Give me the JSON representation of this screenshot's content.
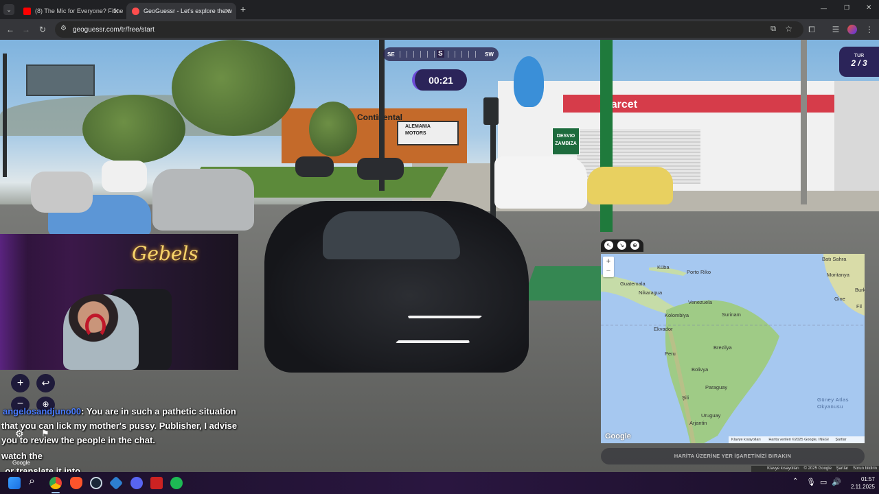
{
  "browser": {
    "tabs": [
      {
        "title": "(8) The Mic for Everyone? Fifine",
        "active": false
      },
      {
        "title": "GeoGuessr - Let's explore the w",
        "active": true
      }
    ],
    "new_tab": "+",
    "url": "geoguessr.com/tr/free/start",
    "window_controls": {
      "minimize": "—",
      "restore": "❐",
      "close": "✕"
    }
  },
  "hud": {
    "compass": {
      "left": "SE",
      "center": "S",
      "right": "SW"
    },
    "timer": "00:21",
    "round": {
      "label": "TUR",
      "value": "2 / 3"
    }
  },
  "scene_signs": {
    "store1": "ALEMANIA",
    "store1b": "MOTORS",
    "store2": "Continental",
    "store3": "parcet",
    "street": "DESVIO ZAMBIZA"
  },
  "webcam": {
    "neon": "Gebels"
  },
  "map_controls": {
    "zoom_in": "+",
    "zoom_out": "−",
    "undo": "↩"
  },
  "map": {
    "zoom_in": "+",
    "zoom_out": "−",
    "labels": [
      "Küba",
      "Porto Riko",
      "Guatemala",
      "Nikaragua",
      "Venezuela",
      "Surinam",
      "Kolombiya",
      "Ekvador",
      "Peru",
      "Brezilya",
      "Bolivya",
      "Paraguay",
      "Şili",
      "Uruguay",
      "Arjantin",
      "Güney Atlas Okyanusu",
      "Batı Sahra",
      "Moritanya",
      "Gine",
      "Burk",
      "Fil"
    ],
    "logo": "Google",
    "footer_shortcuts": "Klavye kısayolları",
    "footer_data": "Harita verileri ©2025 Google, INEGI",
    "footer_terms": "Şartlar",
    "place_button": "HARİTA ÜZERİNE YER İŞARETİNİZİ BIRAKIN"
  },
  "chat": {
    "user": "angelosandjuno00",
    "lines": [
      ": You are in such a pathetic situation",
      "that you can lick my mother's pussy. Publisher, I advise",
      "you to review the people in the chat.",
      "watch the",
      ", or translate it into"
    ]
  },
  "street_footer": {
    "google": "Google",
    "shortcuts": "Klavye kısayolları",
    "copyright": "© 2025 Google",
    "terms": "Şartlar",
    "report": "Sorun bildirin"
  },
  "taskbar": {
    "time": "01:57",
    "date": "2.11.2025"
  }
}
